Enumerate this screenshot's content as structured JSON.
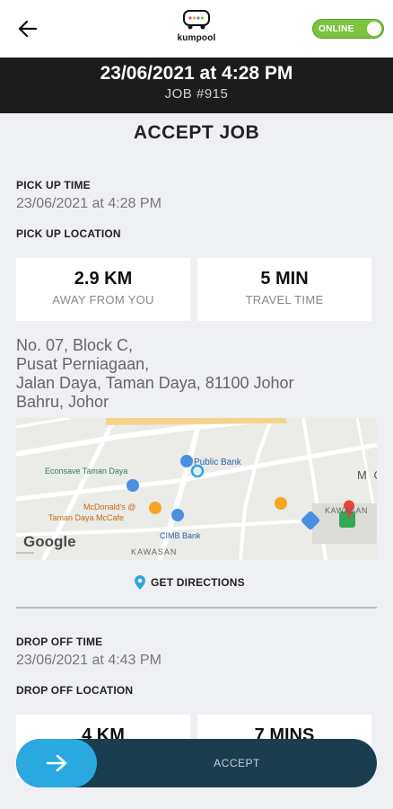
{
  "app": {
    "logo_text": "kumpool",
    "status_toggle": "ONLINE"
  },
  "header": {
    "datetime": "23/06/2021 at 4:28 PM",
    "job_number": "JOB #915"
  },
  "page_title": "ACCEPT JOB",
  "pickup": {
    "time_label": "PICK UP TIME",
    "time_value": "23/06/2021 at 4:28 PM",
    "location_label": "PICK UP LOCATION",
    "distance_value": "2.9 KM",
    "distance_caption": "AWAY FROM YOU",
    "travel_value": "5 MIN",
    "travel_caption": "TRAVEL TIME",
    "address_lines": [
      "No. 07, Block C,",
      "Pusat Perniagaan,",
      "Jalan Daya, Taman Daya, 81100 Johor",
      "Bahru, Johor"
    ]
  },
  "map": {
    "labels": {
      "econsave": "Econsave Taman Daya",
      "public_bank": "Public Bank",
      "mcdonalds_1": "McDonald's @",
      "mcdonalds_2": "Taman Daya McCafe",
      "cimb": "CIMB Bank",
      "kawasan": "KAWASAN",
      "kawasan_right": "KAWASAN",
      "mc": "M C"
    },
    "attribution": "Google"
  },
  "directions_label": "GET DIRECTIONS",
  "dropoff": {
    "time_label": "DROP OFF TIME",
    "time_value": "23/06/2021 at 4:43 PM",
    "location_label": "DROP OFF LOCATION",
    "distance_value": "4 KM",
    "travel_value": "7 MINS"
  },
  "accept_button_label": "ACCEPT",
  "colors": {
    "accent_blue": "#2aa8e0",
    "accept_bar": "#1b3e4f",
    "online_green": "#7cc43d",
    "header_dark": "#1c1c1c"
  }
}
